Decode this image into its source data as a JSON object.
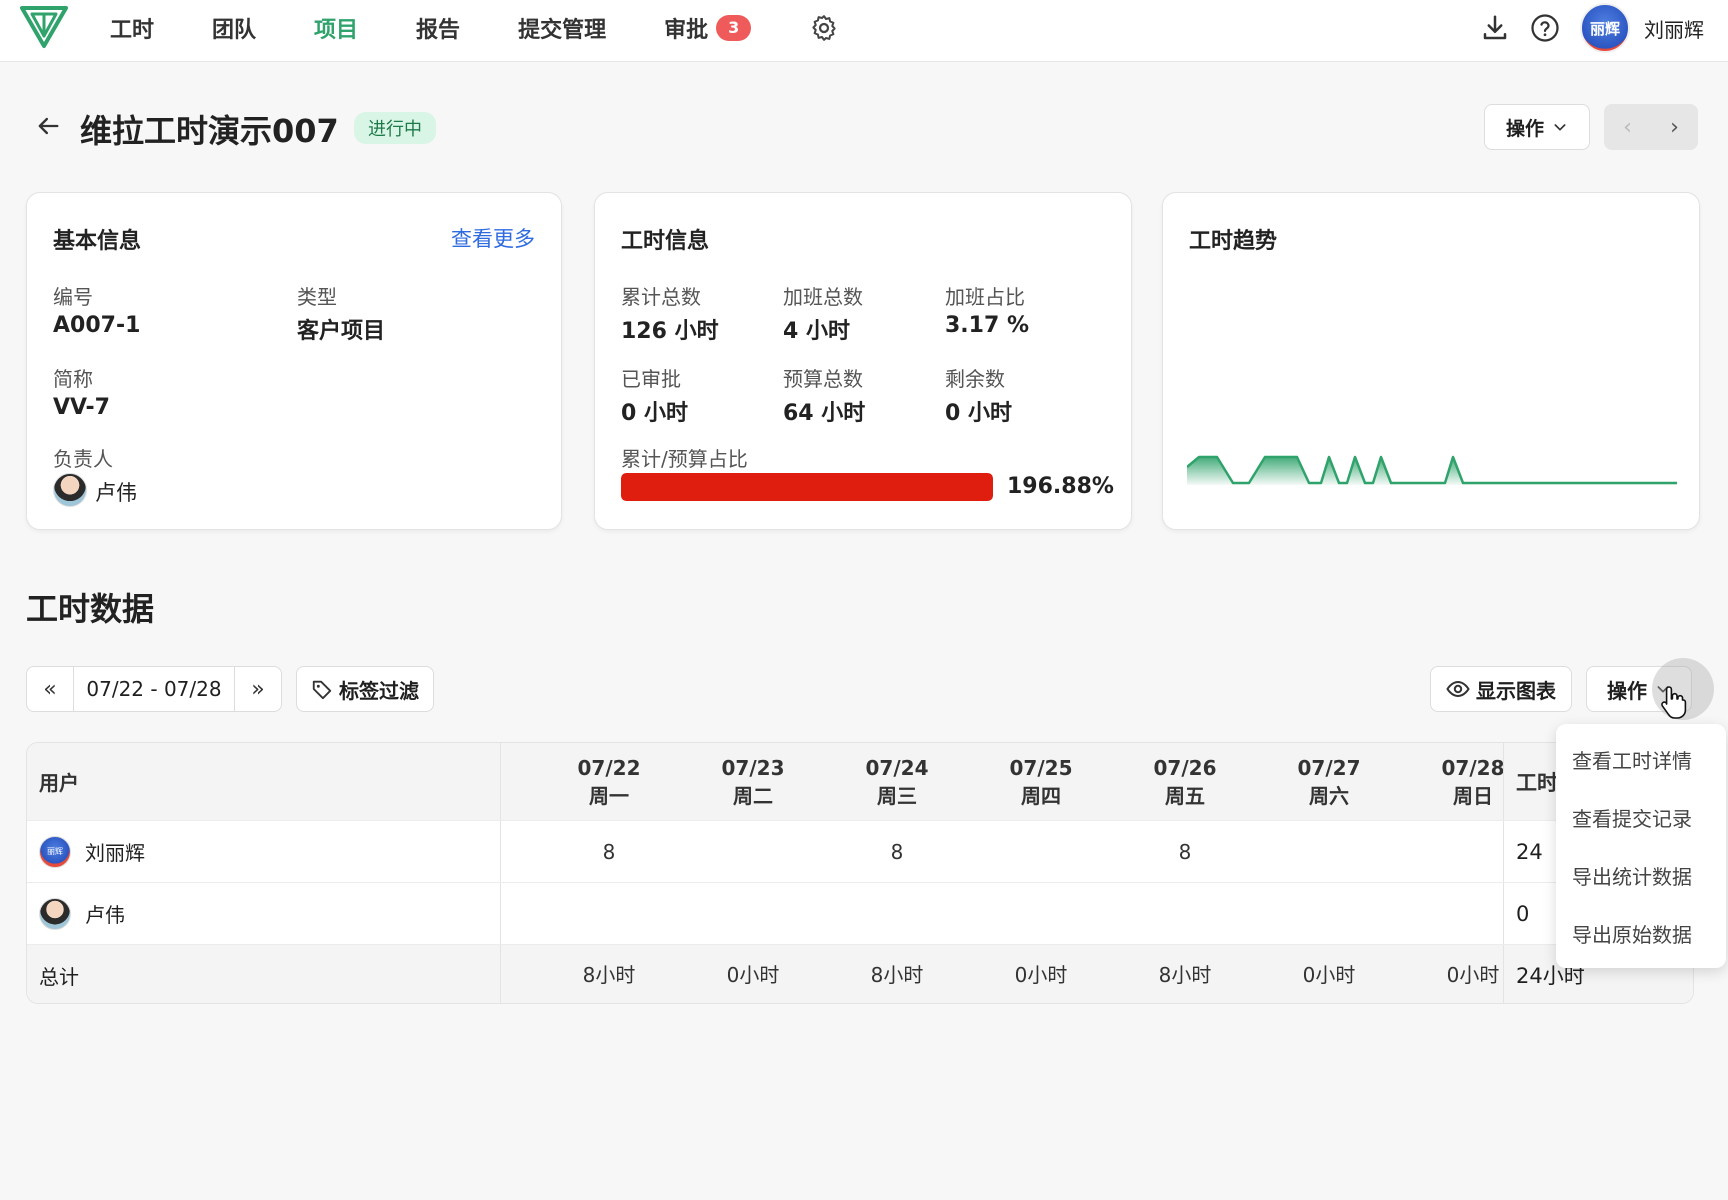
{
  "nav": {
    "items": [
      {
        "label": "工时"
      },
      {
        "label": "团队"
      },
      {
        "label": "项目"
      },
      {
        "label": "报告"
      },
      {
        "label": "提交管理"
      },
      {
        "label": "审批",
        "badge": "3"
      }
    ],
    "active": "项目",
    "accent_color": "#2fa36b",
    "icons": [
      "gear-icon",
      "download-icon",
      "help-icon"
    ],
    "avatar_text": "丽辉",
    "user_name": "刘丽辉"
  },
  "header": {
    "title": "维拉工时演示007",
    "status": "进行中",
    "action_label": "操作"
  },
  "basic_info": {
    "title": "基本信息",
    "more_link": "查看更多",
    "code_label": "编号",
    "code_value": "A007-1",
    "type_label": "类型",
    "type_value": "客户项目",
    "abbr_label": "简称",
    "abbr_value": "VV-7",
    "owner_label": "负责人",
    "owner_value": "卢伟"
  },
  "hours_info": {
    "title": "工时信息",
    "total_label": "累计总数",
    "total_value": "126 小时",
    "overtime_label": "加班总数",
    "overtime_value": "4 小时",
    "overtime_ratio_label": "加班占比",
    "overtime_ratio_value": "3.17 %",
    "approved_label": "已审批",
    "approved_value": "0 小时",
    "budget_label": "预算总数",
    "budget_value": "64 小时",
    "remaining_label": "剩余数",
    "remaining_value": "0 小时",
    "ratio_label": "累计/预算占比",
    "ratio_text": "196.88%",
    "ratio_fill_fraction": 1.0,
    "bar_color": "#e01e0f"
  },
  "trend": {
    "title": "工时趋势",
    "line_color": "#2fa36b"
  },
  "section": {
    "title": "工时数据",
    "date_range": "07/22 - 07/28",
    "tag_filter_label": "标签过滤",
    "show_chart_label": "显示图表",
    "action_label": "操作"
  },
  "table": {
    "user_header": "用户",
    "total_header": "工时",
    "days": [
      {
        "date": "07/22",
        "weekday": "周一"
      },
      {
        "date": "07/23",
        "weekday": "周二"
      },
      {
        "date": "07/24",
        "weekday": "周三"
      },
      {
        "date": "07/25",
        "weekday": "周四"
      },
      {
        "date": "07/26",
        "weekday": "周五"
      },
      {
        "date": "07/27",
        "weekday": "周六"
      },
      {
        "date": "07/28",
        "weekday": "周日"
      }
    ],
    "rows": [
      {
        "name": "刘丽辉",
        "avatar_text": "丽辉",
        "cells": [
          "8",
          "",
          "8",
          "",
          "8",
          "",
          ""
        ],
        "total": "24"
      },
      {
        "name": "卢伟",
        "cells": [
          "",
          "",
          "",
          "",
          "",
          "",
          ""
        ],
        "total": "0"
      }
    ],
    "total_row": {
      "label": "总计",
      "cells": [
        "8小时",
        "0小时",
        "8小时",
        "0小时",
        "8小时",
        "0小时",
        "0小时"
      ],
      "total": "24小时"
    }
  },
  "dropdown": {
    "items": [
      "查看工时详情",
      "查看提交记录",
      "导出统计数据",
      "导出原始数据"
    ]
  }
}
